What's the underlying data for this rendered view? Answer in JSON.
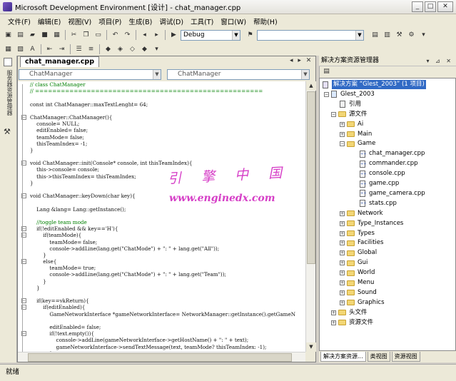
{
  "window": {
    "title": "Microsoft Development Environment [设计] - chat_manager.cpp"
  },
  "menu": [
    "文件(F)",
    "编辑(E)",
    "视图(V)",
    "项目(P)",
    "生成(B)",
    "调试(D)",
    "工具(T)",
    "窗口(W)",
    "帮助(H)"
  ],
  "toolbar": {
    "config": "Debug",
    "target": ""
  },
  "editor": {
    "tab": "chat_manager.cpp",
    "class_combo": "ChatManager",
    "member_combo": "ChatManager",
    "lines": [
      {
        "t": "// class ChatManager",
        "cls": "cm"
      },
      {
        "t": "// =====================================================",
        "cls": "cm"
      },
      {
        "t": "",
        "cls": ""
      },
      {
        "t": "const int ChatManager::maxTextLenght= 64;",
        "cls": ""
      },
      {
        "t": "",
        "cls": ""
      },
      {
        "t": "ChatManager::ChatManager(){",
        "cls": "",
        "fold": true
      },
      {
        "t": "    console= NULL;",
        "cls": ""
      },
      {
        "t": "    editEnabled= false;",
        "cls": ""
      },
      {
        "t": "    teamMode= false;",
        "cls": ""
      },
      {
        "t": "    thisTeamIndex= -1;",
        "cls": ""
      },
      {
        "t": "}",
        "cls": ""
      },
      {
        "t": "",
        "cls": ""
      },
      {
        "t": "void ChatManager::init(Console* console, int thisTeamIndex){",
        "cls": "",
        "fold": true
      },
      {
        "t": "    this->console= console;",
        "cls": ""
      },
      {
        "t": "    this->thisTeamIndex= thisTeamIndex;",
        "cls": ""
      },
      {
        "t": "}",
        "cls": ""
      },
      {
        "t": "",
        "cls": ""
      },
      {
        "t": "void ChatManager::keyDown(char key){",
        "cls": "",
        "fold": true
      },
      {
        "t": "",
        "cls": ""
      },
      {
        "t": "    Lang &lang= Lang::getInstance();",
        "cls": ""
      },
      {
        "t": "",
        "cls": ""
      },
      {
        "t": "    //toggle team mode",
        "cls": "cm"
      },
      {
        "t": "    if(!editEnabled && key=='H'){",
        "cls": "",
        "fold": true
      },
      {
        "t": "        if(teamMode){",
        "cls": "",
        "fold": true
      },
      {
        "t": "            teamMode= false;",
        "cls": ""
      },
      {
        "t": "            console->addLine(lang.get(\"ChatMode\") + \": \" + lang.get(\"All\"));",
        "cls": ""
      },
      {
        "t": "        }",
        "cls": ""
      },
      {
        "t": "        else{",
        "cls": "",
        "fold": true
      },
      {
        "t": "            teamMode= true;",
        "cls": ""
      },
      {
        "t": "            console->addLine(lang.get(\"ChatMode\") + \": \" + lang.get(\"Team\"));",
        "cls": ""
      },
      {
        "t": "        }",
        "cls": ""
      },
      {
        "t": "    }",
        "cls": ""
      },
      {
        "t": "",
        "cls": ""
      },
      {
        "t": "    if(key==vkReturn){",
        "cls": "",
        "fold": true
      },
      {
        "t": "        if(editEnabled){",
        "cls": "",
        "fold": true
      },
      {
        "t": "            GameNetworkInterface *gameNetworkInterface= NetworkManager::getInstance().getGameN",
        "cls": ""
      },
      {
        "t": "",
        "cls": ""
      },
      {
        "t": "            editEnabled= false;",
        "cls": ""
      },
      {
        "t": "            if(!text.empty()){",
        "cls": "",
        "fold": true
      },
      {
        "t": "                console->addLine(gameNetworkInterface->getHostName() + \": \" + text);",
        "cls": ""
      },
      {
        "t": "                gameNetworkInterface->sendTextMessage(text, teamMode? thisTeamIndex: -1);",
        "cls": ""
      },
      {
        "t": "            }",
        "cls": ""
      },
      {
        "t": "        }",
        "cls": ""
      }
    ]
  },
  "watermark": {
    "cn": "引擎中国",
    "url": "www.enginedx.com"
  },
  "solution": {
    "panel_title": "解决方案资源管理器",
    "root": "解决方案 “Glest_2003” (1 项目)",
    "project": "Glest_2003",
    "refs": "引用",
    "src": "源文件",
    "folders_before": [
      "Ai",
      "Main"
    ],
    "game_folder": "Game",
    "game_files": [
      "chat_manager.cpp",
      "commander.cpp",
      "console.cpp",
      "game.cpp",
      "game_camera.cpp",
      "stats.cpp"
    ],
    "folders_after": [
      "Network",
      "Type_Instances",
      "Types",
      "Facilities",
      "Global",
      "Gui",
      "World",
      "Menu",
      "Sound",
      "Graphics"
    ],
    "headers": "头文件",
    "resources": "资源文件",
    "tabs": [
      "解决方案资源...",
      "类视图",
      "资源视图"
    ]
  },
  "status": {
    "text": "就绪"
  }
}
